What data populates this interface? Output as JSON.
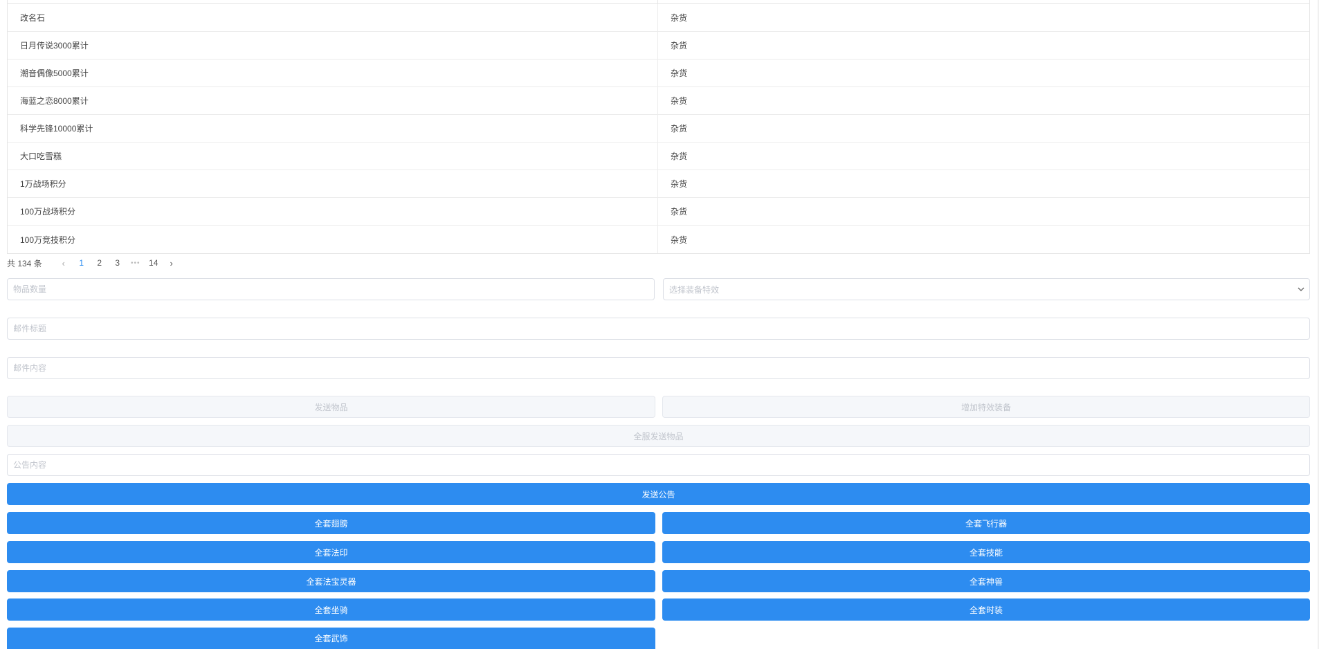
{
  "table": {
    "rows": [
      {
        "name": "改名石",
        "type": "杂货"
      },
      {
        "name": "日月传说3000累计",
        "type": "杂货"
      },
      {
        "name": "潮音偶像5000累计",
        "type": "杂货"
      },
      {
        "name": "海蓝之恋8000累计",
        "type": "杂货"
      },
      {
        "name": "科学先锋10000累计",
        "type": "杂货"
      },
      {
        "name": "大口吃雪糕",
        "type": "杂货"
      },
      {
        "name": "1万战场积分",
        "type": "杂货"
      },
      {
        "name": "100万战场积分",
        "type": "杂货"
      },
      {
        "name": "100万竞技积分",
        "type": "杂货"
      }
    ]
  },
  "pagination": {
    "total_text": "共 134 条",
    "prev": "‹",
    "pages": [
      "1",
      "2",
      "3"
    ],
    "ellipsis": "•••",
    "last": "14",
    "next": "›",
    "current": "1"
  },
  "form": {
    "quantity_placeholder": "物品数量",
    "effect_select_placeholder": "选择装备特效",
    "mail_title_placeholder": "邮件标题",
    "mail_content_placeholder": "邮件内容",
    "send_item_label": "发送物品",
    "add_effect_equip_label": "增加特效装备",
    "send_all_server_label": "全服发送物品",
    "announcement_placeholder": "公告内容",
    "send_announcement_label": "发送公告"
  },
  "set_buttons": {
    "wings": "全套翅膀",
    "aircraft": "全套飞行器",
    "seal": "全套法印",
    "skills": "全套技能",
    "spirit": "全套法宝灵器",
    "beast": "全套神兽",
    "mount": "全套坐骑",
    "fashion": "全套时装",
    "weapon_deco": "全套武饰"
  },
  "colors": {
    "primary": "#2d8cf0",
    "disabled_bg": "#f5f7fa",
    "placeholder": "#c0c4cc"
  }
}
